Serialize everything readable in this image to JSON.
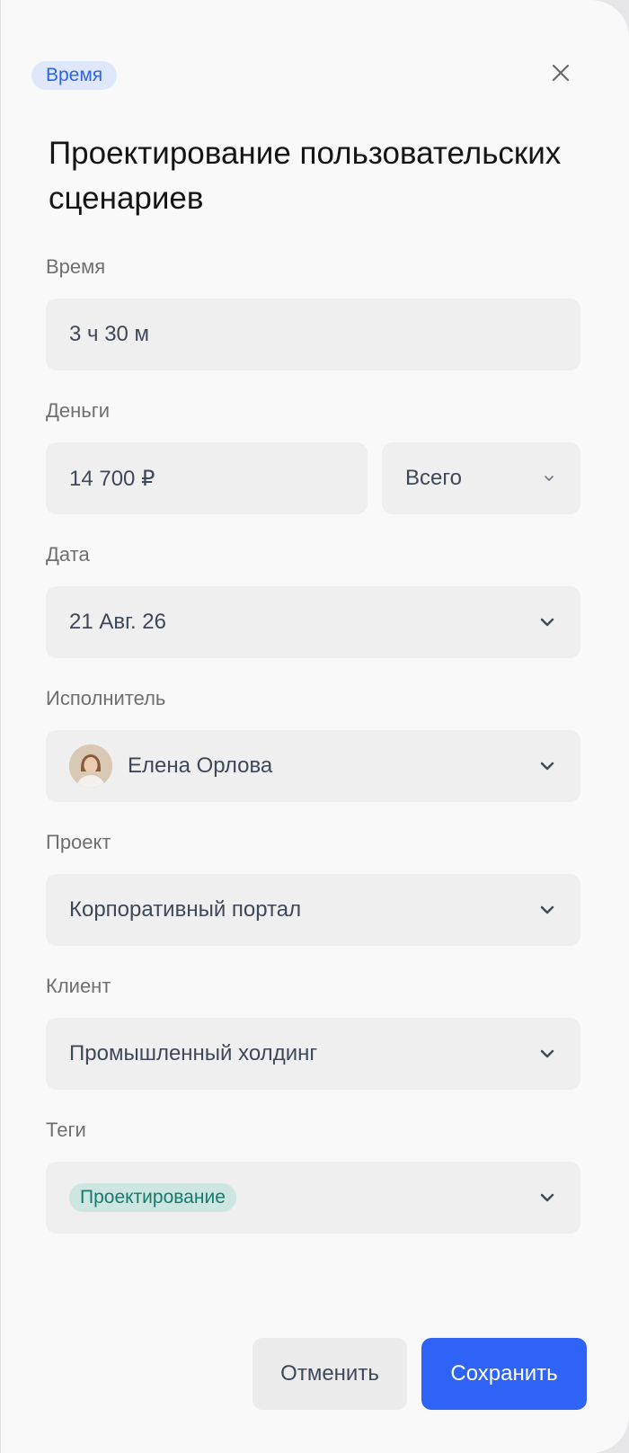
{
  "header": {
    "chip": "Время",
    "title": "Проектирование пользовательских сценариев"
  },
  "fields": {
    "time": {
      "label": "Время",
      "value": "3 ч 30 м"
    },
    "money": {
      "label": "Деньги",
      "value": "14 700 ₽",
      "mode": "Всего"
    },
    "date": {
      "label": "Дата",
      "value": "21 Авг. 26"
    },
    "assignee": {
      "label": "Исполнитель",
      "value": "Елена Орлова"
    },
    "project": {
      "label": "Проект",
      "value": "Корпоративный портал"
    },
    "client": {
      "label": "Клиент",
      "value": "Промышленный холдинг"
    },
    "tags": {
      "label": "Теги",
      "items": [
        "Проектирование"
      ]
    }
  },
  "footer": {
    "cancel_label": "Отменить",
    "save_label": "Сохранить"
  },
  "colors": {
    "accent": "#2e63f5",
    "chip_bg": "#dfe8fb",
    "chip_text": "#2f63e6",
    "tag_bg": "#cde6e1",
    "tag_text": "#177a6a"
  },
  "icons": {
    "close": "close-icon",
    "dropdown": "chevron-down-icon",
    "avatar": "avatar"
  }
}
